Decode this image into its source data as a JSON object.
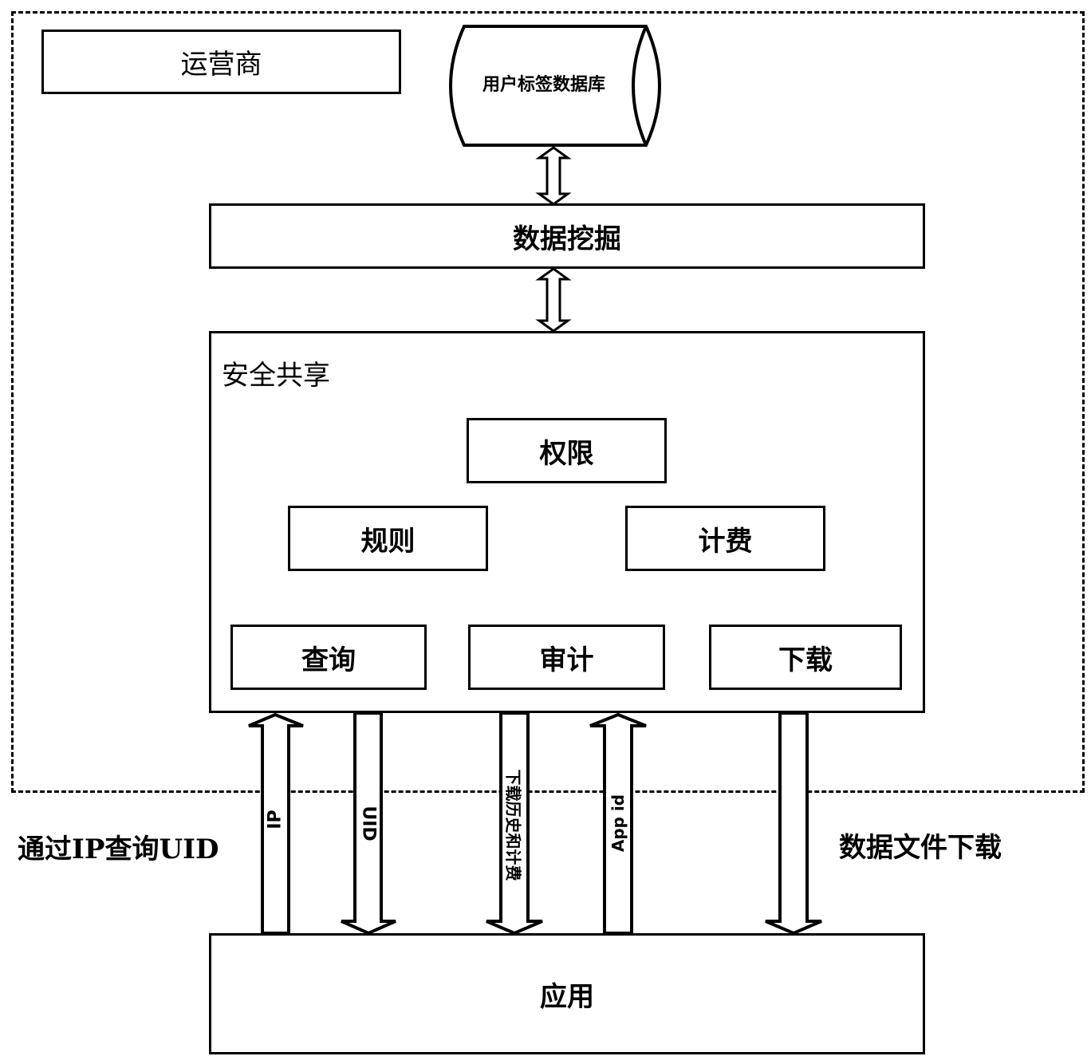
{
  "outer_region": {
    "label": "运营商"
  },
  "database": {
    "label": "用户标签数据库"
  },
  "data_mining": {
    "label": "数据挖掘"
  },
  "secure_sharing": {
    "label": "安全共享",
    "modules": {
      "permission": "权限",
      "rules": "规则",
      "billing": "计费",
      "query": "查询",
      "audit": "审计",
      "download": "下载"
    }
  },
  "application": {
    "label": "应用"
  },
  "flows": {
    "ip": "IP",
    "uid": "UID",
    "history_billing": "下载历史和计费",
    "app_id": "App id"
  },
  "annotations": {
    "left": "通过IP查询UID",
    "right": "数据文件下载"
  }
}
